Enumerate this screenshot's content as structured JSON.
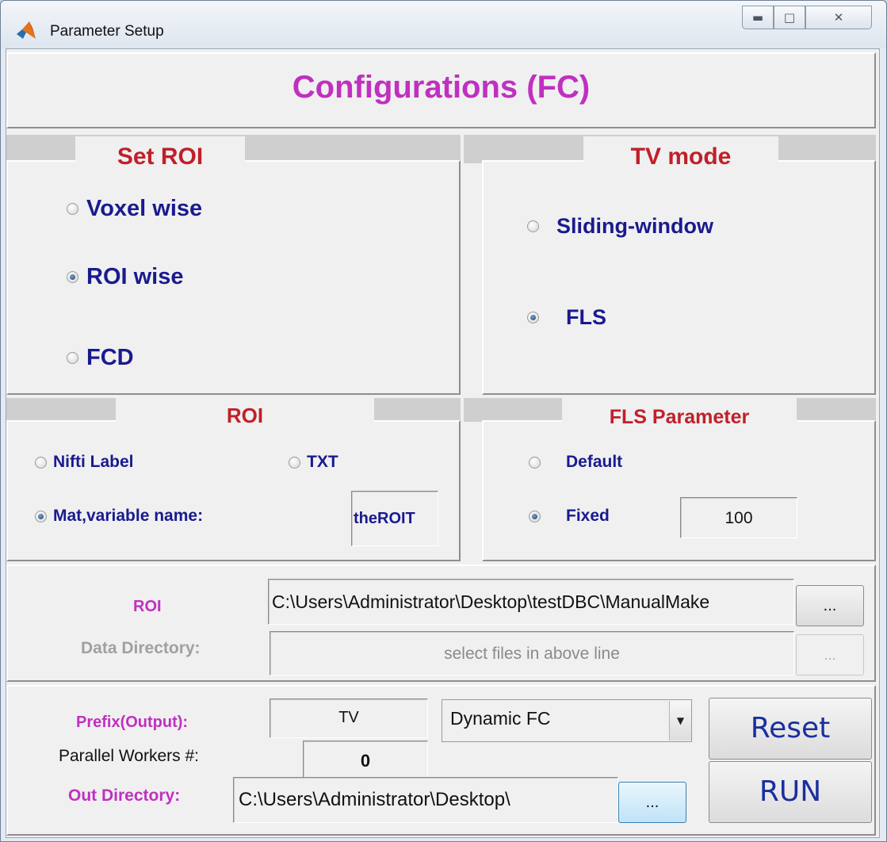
{
  "window": {
    "title": "Parameter Setup"
  },
  "header": {
    "heading": "Configurations (FC)"
  },
  "set_roi": {
    "title": "Set ROI",
    "options": [
      {
        "label": "Voxel wise",
        "selected": false
      },
      {
        "label": "ROI wise",
        "selected": true
      },
      {
        "label": "FCD",
        "selected": false
      }
    ]
  },
  "tv_mode": {
    "title": "TV mode",
    "options": [
      {
        "label": "Sliding-window",
        "selected": false
      },
      {
        "label": "FLS",
        "selected": true
      }
    ]
  },
  "roi_panel": {
    "title": "ROI",
    "nifti_label": "Nifti Label",
    "txt_label": "TXT",
    "mat_label": "Mat,variable name:",
    "variable_value": "theROIT",
    "selected": "mat"
  },
  "fls_parameter": {
    "title": "FLS Parameter",
    "default_label": "Default",
    "fixed_label": "Fixed",
    "fixed_value": "100",
    "selected": "fixed"
  },
  "paths": {
    "roi_label": "ROI",
    "roi_path": "C:\\Users\\Administrator\\Desktop\\testDBC\\ManualMake",
    "browse_label": "...",
    "data_dir_label": "Data Directory:",
    "data_dir_placeholder": "select files in above line",
    "data_browse_label": "..."
  },
  "output": {
    "prefix_label": "Prefix(Output):",
    "prefix_value": "TV",
    "mode_selected": "Dynamic FC",
    "workers_label": "Parallel Workers #:",
    "workers_value": "0",
    "out_dir_label": "Out Directory:",
    "out_dir_value": "C:\\Users\\Administrator\\Desktop\\",
    "out_browse_label": "...",
    "reset_label": "Reset",
    "run_label": "RUN"
  },
  "colors": {
    "heading": "#c030c0",
    "panel_title": "#c0202a",
    "option_text": "#1a1a8f",
    "button_text": "#1a2f9f"
  }
}
